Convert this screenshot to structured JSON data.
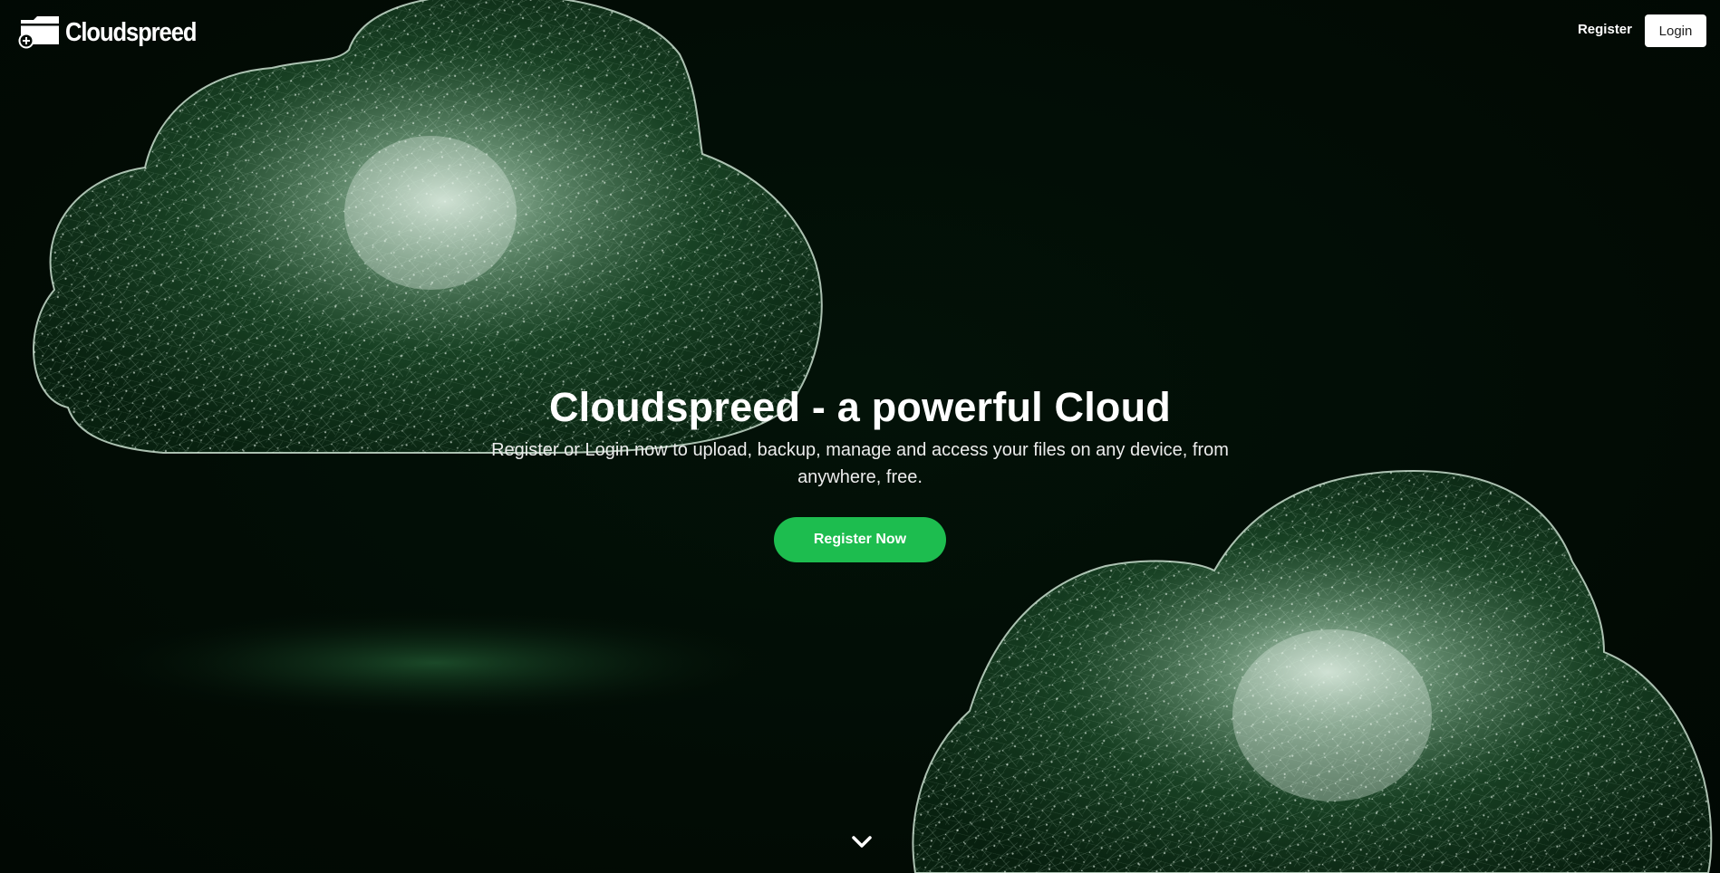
{
  "brand": {
    "name": "Cloudspreed"
  },
  "nav": {
    "register_label": "Register",
    "login_label": "Login"
  },
  "hero": {
    "title": "Cloudspreed - a powerful Cloud",
    "subtitle": "Register or Login now to upload, backup, manage and access your files on any device, from anywhere, free.",
    "cta_label": "Register Now"
  },
  "icons": {
    "logo": "folder-plus-icon",
    "scroll": "chevron-down-icon"
  },
  "colors": {
    "background": "#020b05",
    "cloud_glow": "#2f7a45",
    "accent": "#1dbd4f",
    "text": "#ffffff"
  }
}
